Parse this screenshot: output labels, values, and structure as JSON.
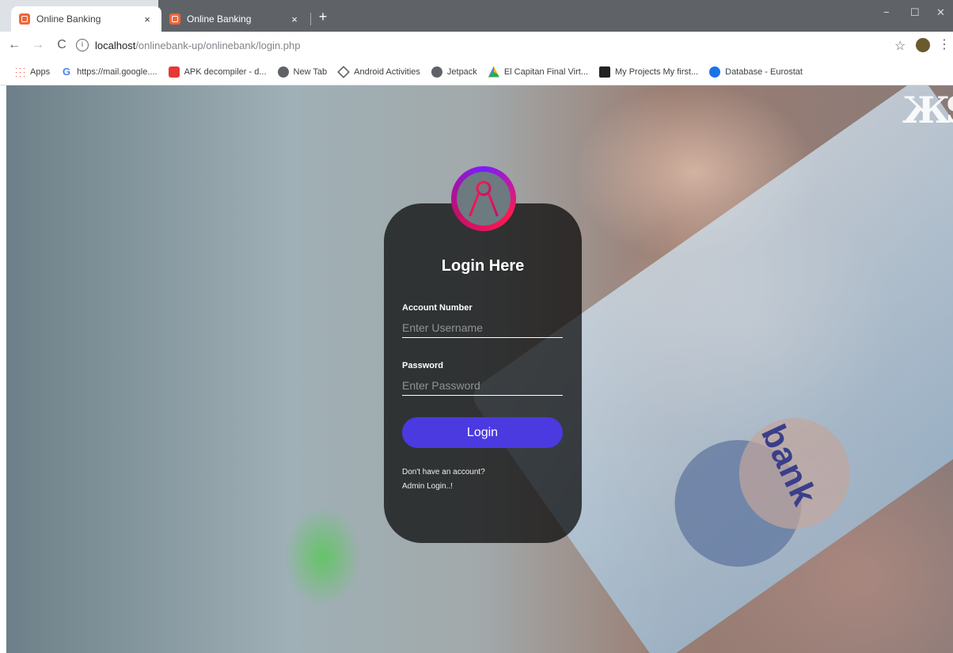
{
  "browser": {
    "tabs": [
      {
        "title": "Online Banking",
        "close": "×"
      },
      {
        "title": "Online Banking",
        "close": "×"
      }
    ],
    "new_tab": "+",
    "window_controls": {
      "minimize": "−",
      "restore": "☐",
      "close": "✕"
    },
    "nav": {
      "back": "←",
      "forward": "→",
      "reload": "C"
    },
    "url": {
      "host": "localhost",
      "path": "/onlinebank-up/onlinebank/login.php",
      "info_icon": "i"
    },
    "star_icon": "☆",
    "menu_icon": "⋮",
    "bookmarks": [
      {
        "label": "Apps",
        "icon": "apps-grid-icon"
      },
      {
        "label": "https://mail.google....",
        "icon": "google-icon"
      },
      {
        "label": "APK decompiler - d...",
        "icon": "apk-icon"
      },
      {
        "label": "New Tab",
        "icon": "globe-icon"
      },
      {
        "label": "Android Activities",
        "icon": "diamond-icon"
      },
      {
        "label": "Jetpack",
        "icon": "globe-icon"
      },
      {
        "label": "El Capitan Final Virt...",
        "icon": "google-drive-icon"
      },
      {
        "label": "My Projects My first...",
        "icon": "project-icon"
      },
      {
        "label": "Database - Eurostat",
        "icon": "database-icon"
      }
    ]
  },
  "page": {
    "logo_text": "ЖS",
    "background_text": "bank",
    "login": {
      "title": "Login Here",
      "account_label": "Account Number",
      "account_placeholder": "Enter Username",
      "password_label": "Password",
      "password_placeholder": "Enter Password",
      "button": "Login",
      "no_account": "Don't have an account?",
      "admin_login": "Admin Login..!"
    },
    "colors": {
      "button": "#4a3ae0",
      "ring_start": "#ff1a4f",
      "ring_end": "#7a1cff"
    }
  }
}
